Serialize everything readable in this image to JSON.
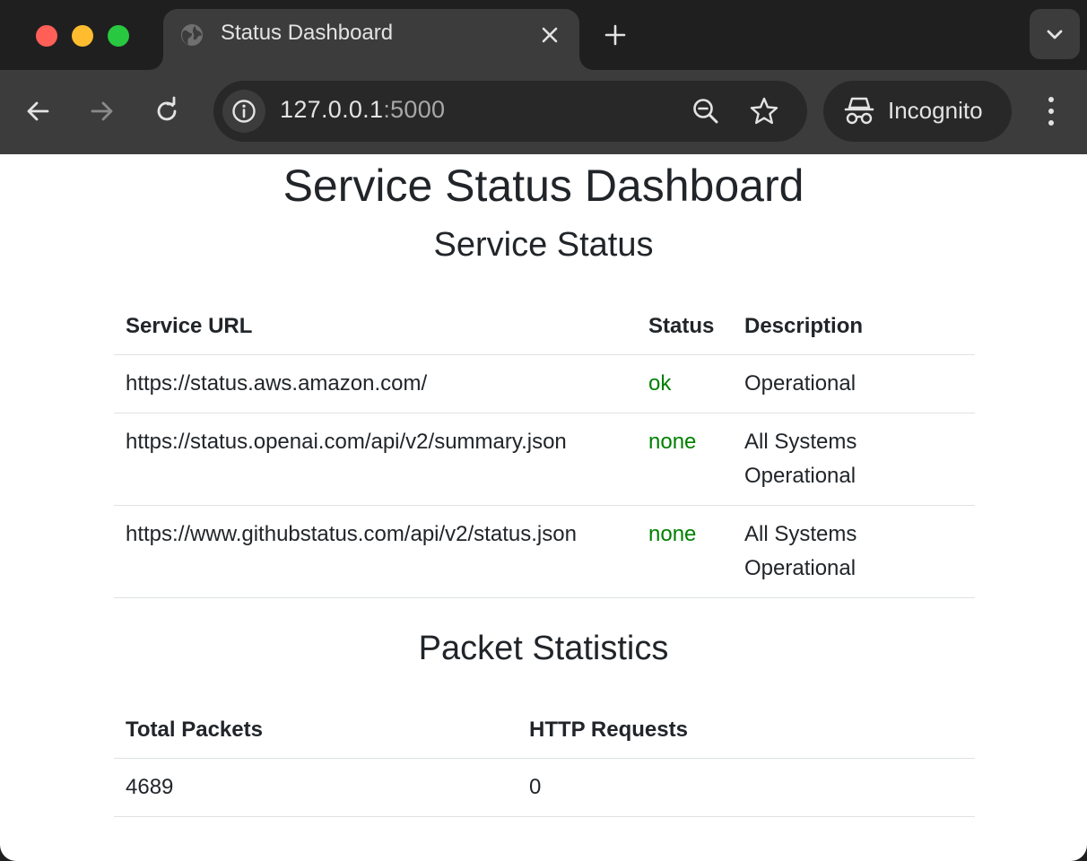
{
  "browser": {
    "tab_title": "Status Dashboard",
    "url_host": "127.0.0.1",
    "url_port": ":5000",
    "incognito_label": "Incognito"
  },
  "page": {
    "title": "Service Status Dashboard",
    "service_section": {
      "heading": "Service Status",
      "columns": [
        "Service URL",
        "Status",
        "Description"
      ],
      "rows": [
        {
          "url": "https://status.aws.amazon.com/",
          "status": "ok",
          "description": "Operational"
        },
        {
          "url": "https://status.openai.com/api/v2/summary.json",
          "status": "none",
          "description": "All Systems Operational"
        },
        {
          "url": "https://www.githubstatus.com/api/v2/status.json",
          "status": "none",
          "description": "All Systems Operational"
        }
      ]
    },
    "packet_section": {
      "heading": "Packet Statistics",
      "columns": [
        "Total Packets",
        "HTTP Requests"
      ],
      "values": [
        "4689",
        "0"
      ]
    }
  },
  "colors": {
    "status_text": "#008000",
    "body_text": "#212529",
    "chrome_dark": "#1f1f1f",
    "chrome_toolbar": "#3c3c3c"
  },
  "icons": [
    "globe-icon",
    "close-icon",
    "plus-icon",
    "chevron-down-icon",
    "back-arrow-icon",
    "forward-arrow-icon",
    "reload-icon",
    "info-icon",
    "zoom-out-icon",
    "star-icon",
    "incognito-icon",
    "kebab-menu-icon"
  ]
}
